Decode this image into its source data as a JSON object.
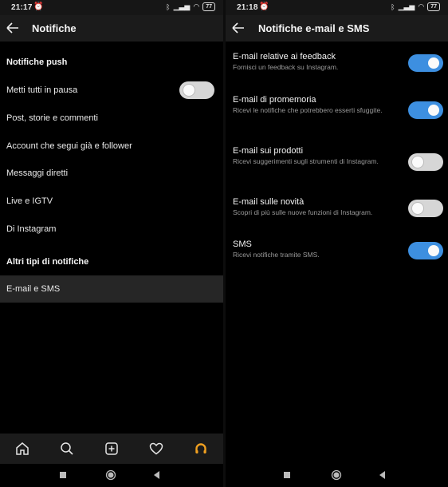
{
  "left": {
    "status": {
      "time": "21:17",
      "battery": "77"
    },
    "title": "Notifiche",
    "items": [
      {
        "label": "Notifiche push",
        "type": "header"
      },
      {
        "label": "Metti tutti in pausa",
        "type": "toggle",
        "on": false
      },
      {
        "label": "Post, storie e commenti"
      },
      {
        "label": "Account che segui già e follower"
      },
      {
        "label": "Messaggi diretti"
      },
      {
        "label": "Live e IGTV"
      },
      {
        "label": "Di Instagram"
      },
      {
        "label": "Altri tipi di notifiche",
        "type": "header"
      },
      {
        "label": "E-mail e SMS",
        "selected": true
      }
    ],
    "tabs": [
      "home-icon",
      "search-icon",
      "add-post-icon",
      "heart-icon",
      "profile-icon"
    ],
    "profile_accent": "#f0a020"
  },
  "right": {
    "status": {
      "time": "21:18",
      "battery": "77"
    },
    "title": "Notifiche e-mail e SMS",
    "options": [
      {
        "title": "E-mail relative ai feedback",
        "desc": "Fornisci un feedback su Instagram.",
        "on": true
      },
      {
        "title": "E-mail di promemoria",
        "desc": "Ricevi le notifiche che potrebbero esserti sfuggite.",
        "on": true
      },
      {
        "title": "E-mail sui prodotti",
        "desc": "Ricevi suggerimenti sugli strumenti di Instagram.",
        "on": false
      },
      {
        "title": "E-mail sulle novità",
        "desc": "Scopri di più sulle nuove funzioni di Instagram.",
        "on": false
      },
      {
        "title": "SMS",
        "desc": "Ricevi notifiche tramite SMS.",
        "on": true
      }
    ]
  },
  "colors": {
    "toggle_on": "#3d8fe0",
    "toggle_off": "#d6d6d6",
    "background": "#000000"
  }
}
